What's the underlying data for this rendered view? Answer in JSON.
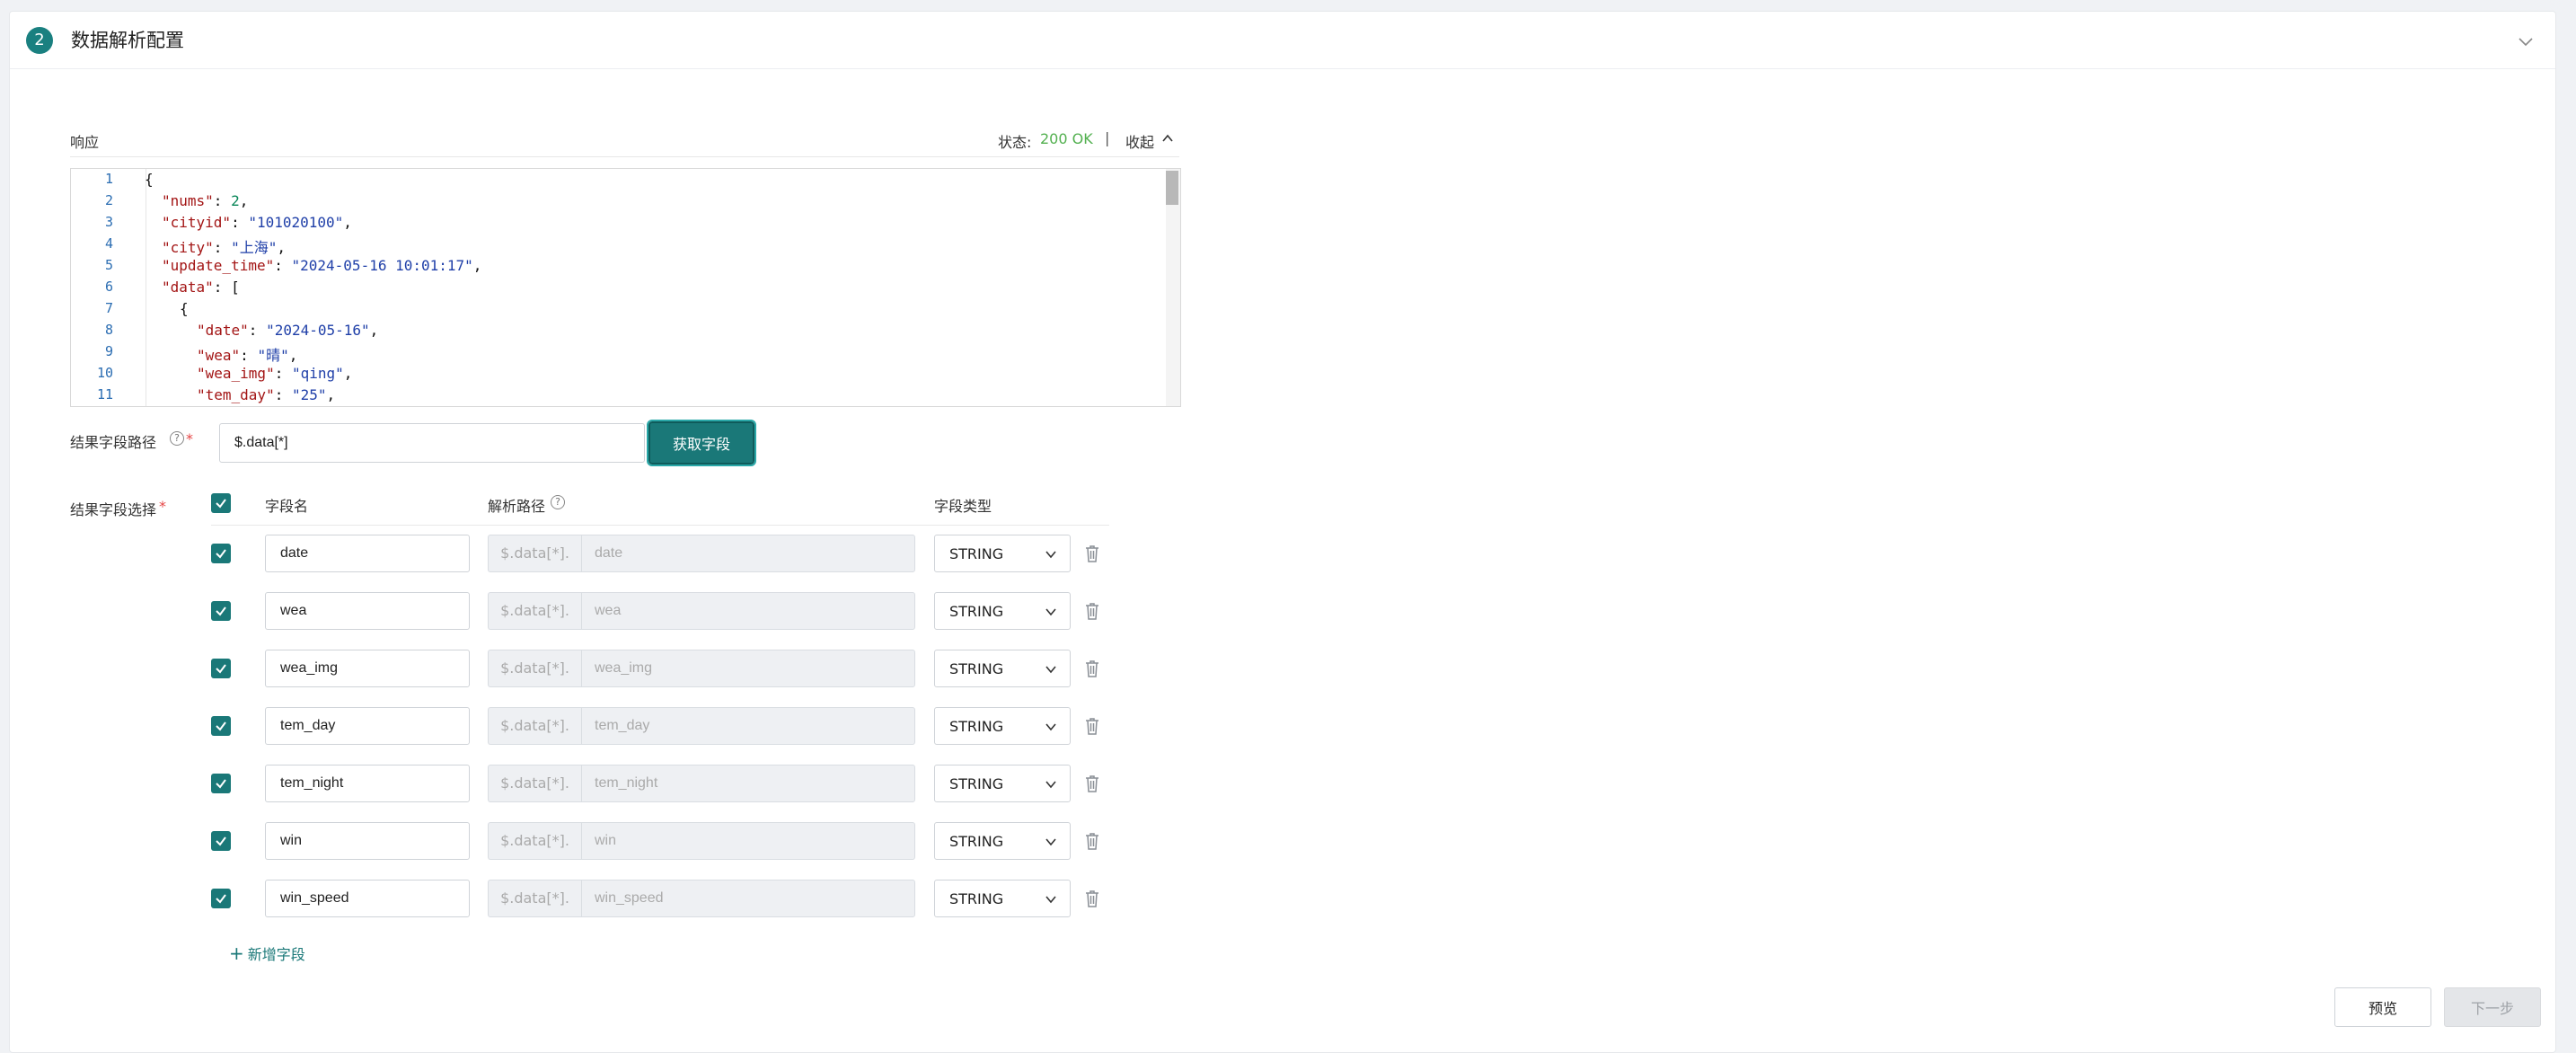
{
  "header": {
    "step_number": "2",
    "title": "数据解析配置"
  },
  "response": {
    "label": "响应",
    "status_label": "状态:",
    "status_value": "200 OK",
    "separator": "|",
    "collapse_label": "收起",
    "status_color": "#52b04f"
  },
  "code_editor": {
    "lines": [
      {
        "n": "1"
      },
      {
        "n": "2"
      },
      {
        "n": "3"
      },
      {
        "n": "4"
      },
      {
        "n": "5"
      },
      {
        "n": "6"
      },
      {
        "n": "7"
      },
      {
        "n": "8"
      },
      {
        "n": "9"
      },
      {
        "n": "10"
      },
      {
        "n": "11"
      }
    ],
    "tokens": {
      "l1_open": "{",
      "l2_key": "\"nums\"",
      "l2_val": "2",
      "l3_key": "\"cityid\"",
      "l3_val": "\"101020100\"",
      "l4_key": "\"city\"",
      "l4_val": "\"上海\"",
      "l5_key": "\"update_time\"",
      "l5_val": "\"2024-05-16 10:01:17\"",
      "l6_key": "\"data\"",
      "l6_val": "[",
      "l7_open": "{",
      "l8_key": "\"date\"",
      "l8_val": "\"2024-05-16\"",
      "l9_key": "\"wea\"",
      "l9_val": "\"晴\"",
      "l10_key": "\"wea_img\"",
      "l10_val": "\"qing\"",
      "l11_key": "\"tem_day\"",
      "l11_val": "\"25\""
    }
  },
  "result_path": {
    "label": "结果字段路径",
    "required_mark": "*",
    "help_glyph": "?",
    "value": "$.data[*]",
    "fetch_button": "获取字段"
  },
  "field_select": {
    "label": "结果字段选择",
    "required_mark": "*",
    "columns": {
      "name": "字段名",
      "path": "解析路径",
      "path_help": "?",
      "type": "字段类型"
    },
    "path_prefix": "$.data[*].",
    "rows": [
      {
        "name": "date",
        "path": "date",
        "type": "STRING"
      },
      {
        "name": "wea",
        "path": "wea",
        "type": "STRING"
      },
      {
        "name": "wea_img",
        "path": "wea_img",
        "type": "STRING"
      },
      {
        "name": "tem_day",
        "path": "tem_day",
        "type": "STRING"
      },
      {
        "name": "tem_night",
        "path": "tem_night",
        "type": "STRING"
      },
      {
        "name": "win",
        "path": "win",
        "type": "STRING"
      },
      {
        "name": "win_speed",
        "path": "win_speed",
        "type": "STRING"
      }
    ],
    "add_field_icon": "+",
    "add_field_label": "新增字段"
  },
  "footer": {
    "preview_button": "预览",
    "next_button": "下一步"
  },
  "colors": {
    "accent": "#1a7878",
    "required": "#e54545"
  },
  "icons": {
    "collapse": "chevron-up-icon",
    "section_toggle": "chevron-down-icon",
    "select": "chevron-down-icon",
    "delete": "trash-icon",
    "checkbox": "check-icon"
  }
}
